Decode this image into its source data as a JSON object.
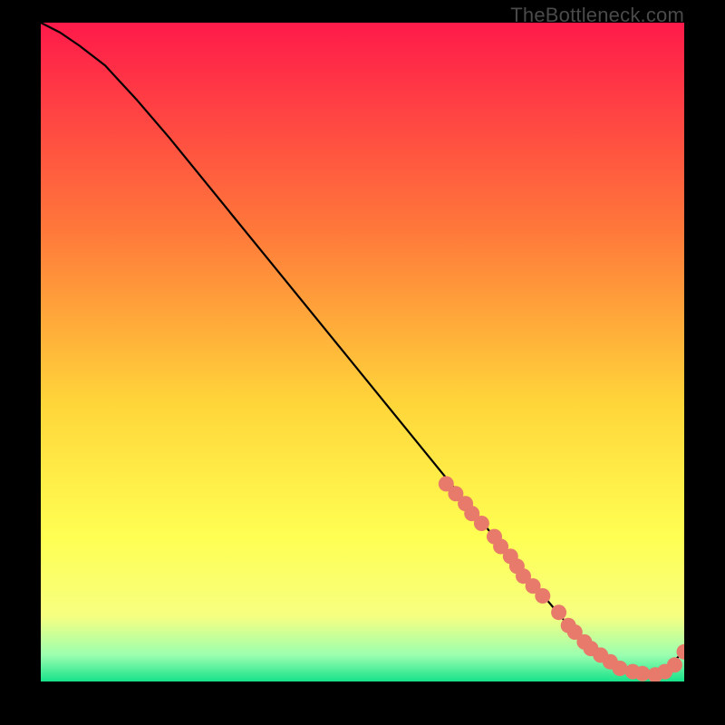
{
  "watermark": "TheBottleneck.com",
  "colors": {
    "background": "#000000",
    "gradient_top": "#ff1a4a",
    "gradient_mid1": "#ff7a3a",
    "gradient_mid2": "#ffd63a",
    "gradient_mid3": "#ffff52",
    "gradient_bottom_yellow": "#f7ff80",
    "gradient_green": "#18e28a",
    "curve": "#000000",
    "marker_fill": "#e77a6a",
    "marker_stroke": "#c95b4c"
  },
  "chart_data": {
    "type": "line",
    "title": "",
    "xlabel": "",
    "ylabel": "",
    "xlim": [
      0,
      100
    ],
    "ylim": [
      0,
      100
    ],
    "series": [
      {
        "name": "bottleneck-curve",
        "x": [
          0,
          3,
          6,
          10,
          15,
          20,
          25,
          30,
          35,
          40,
          45,
          50,
          55,
          60,
          65,
          70,
          73,
          76,
          79,
          82,
          85,
          88,
          91,
          94,
          97,
          100
        ],
        "y": [
          100,
          98.5,
          96.5,
          93.5,
          88.2,
          82.5,
          76.5,
          70.5,
          64.5,
          58.5,
          52.5,
          46.5,
          40.5,
          34.5,
          28.5,
          22.5,
          19,
          15.5,
          12,
          8.5,
          5.5,
          3,
          1.5,
          1,
          2,
          4.5
        ]
      }
    ],
    "markers": {
      "name": "highlighted-points",
      "x": [
        63,
        64.5,
        66,
        67,
        68.5,
        70.5,
        71.5,
        73,
        74,
        75,
        76.5,
        78,
        80.5,
        82,
        83,
        84.5,
        85.5,
        87,
        88.5,
        90,
        92,
        93.5,
        95.5,
        97,
        98.5,
        100
      ],
      "y": [
        30,
        28.5,
        27,
        25.5,
        24,
        22,
        20.5,
        19,
        17.5,
        16,
        14.5,
        13,
        10.5,
        8.5,
        7.5,
        6,
        5,
        4,
        3,
        2,
        1.5,
        1.2,
        1,
        1.5,
        2.5,
        4.5
      ]
    }
  }
}
